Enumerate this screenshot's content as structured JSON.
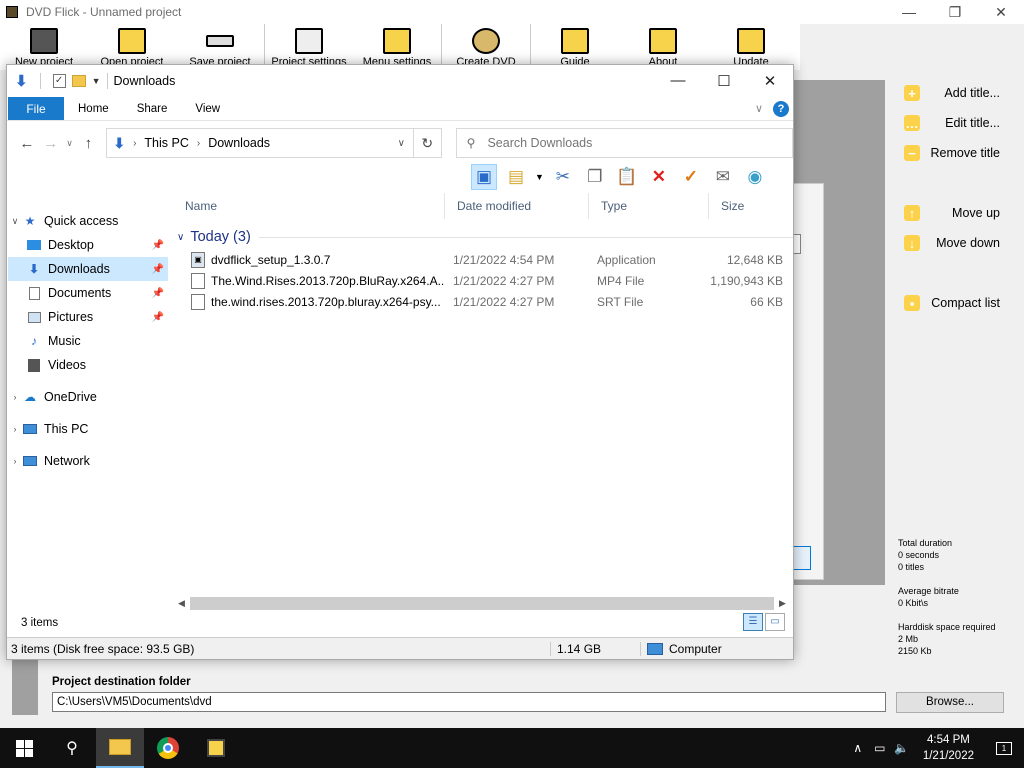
{
  "dvd_flick": {
    "window_title": "DVD Flick - Unnamed project",
    "toolbar": [
      {
        "label": "New project",
        "icon": "film-icon"
      },
      {
        "label": "Open project",
        "icon": "folder-icon"
      },
      {
        "label": "Save project",
        "icon": "disk-icon"
      },
      {
        "label": "Project settings",
        "icon": "settings-icon"
      },
      {
        "label": "Menu settings",
        "icon": "menu-icon"
      },
      {
        "label": "Create DVD",
        "icon": "disc-icon"
      },
      {
        "label": "Guide",
        "icon": "guide-icon"
      },
      {
        "label": "About",
        "icon": "about-icon"
      },
      {
        "label": "Update",
        "icon": "update-icon"
      }
    ],
    "side_actions": [
      {
        "label": "Add title...",
        "icon": "+"
      },
      {
        "label": "Edit title...",
        "icon": "…"
      },
      {
        "label": "Remove title",
        "icon": "−"
      },
      {
        "label": "Move up",
        "icon": "↑"
      },
      {
        "label": "Move down",
        "icon": "↓"
      },
      {
        "label": "Compact list",
        "icon": "▪"
      }
    ],
    "stats": {
      "duration_label": "Total duration",
      "duration_seconds": "0 seconds",
      "duration_titles": "0 titles",
      "bitrate_label": "Average bitrate",
      "bitrate_value": "0 Kbit\\s",
      "disk_label": "Harddisk space required",
      "disk_mb": "2 Mb",
      "disk_kb": "2150 Kb"
    },
    "destination_label": "Project destination folder",
    "destination_value": "C:\\Users\\VM5\\Documents\\dvd",
    "browse_label": "Browse..."
  },
  "explorer": {
    "title": "Downloads",
    "ribbon_tabs": [
      "File",
      "Home",
      "Share",
      "View"
    ],
    "address": {
      "root": "This PC",
      "folder": "Downloads"
    },
    "search_placeholder": "Search Downloads",
    "nav": [
      {
        "label": "Quick access",
        "icon": "star-icon",
        "level": 0,
        "expand": "v"
      },
      {
        "label": "Desktop",
        "icon": "desktop-icon",
        "level": 1,
        "pinned": true
      },
      {
        "label": "Downloads",
        "icon": "download-icon",
        "level": 1,
        "pinned": true,
        "selected": true
      },
      {
        "label": "Documents",
        "icon": "document-icon",
        "level": 1,
        "pinned": true
      },
      {
        "label": "Pictures",
        "icon": "picture-icon",
        "level": 1,
        "pinned": true
      },
      {
        "label": "Music",
        "icon": "music-icon",
        "level": 1
      },
      {
        "label": "Videos",
        "icon": "video-icon",
        "level": 1
      },
      {
        "label": "OneDrive",
        "icon": "cloud-icon",
        "level": 0,
        "expand": ">"
      },
      {
        "label": "This PC",
        "icon": "computer-icon",
        "level": 0,
        "expand": ">"
      },
      {
        "label": "Network",
        "icon": "network-icon",
        "level": 0,
        "expand": ">"
      }
    ],
    "columns": [
      "Name",
      "Date modified",
      "Type",
      "Size"
    ],
    "group": "Today (3)",
    "files": [
      {
        "name": "dvdflick_setup_1.3.0.7",
        "date": "1/21/2022 4:54 PM",
        "type": "Application",
        "size": "12,648 KB"
      },
      {
        "name": "The.Wind.Rises.2013.720p.BluRay.x264.A...",
        "date": "1/21/2022 4:27 PM",
        "type": "MP4 File",
        "size": "1,190,943 KB"
      },
      {
        "name": "the.wind.rises.2013.720p.bluray.x264-psy...",
        "date": "1/21/2022 4:27 PM",
        "type": "SRT File",
        "size": "66 KB"
      }
    ],
    "item_count": "3 items",
    "status": {
      "summary": "3 items (Disk free space: 93.5 GB)",
      "size": "1.14 GB",
      "location": "Computer"
    }
  },
  "taskbar": {
    "time": "4:54 PM",
    "date": "1/21/2022",
    "notification_count": "1"
  }
}
